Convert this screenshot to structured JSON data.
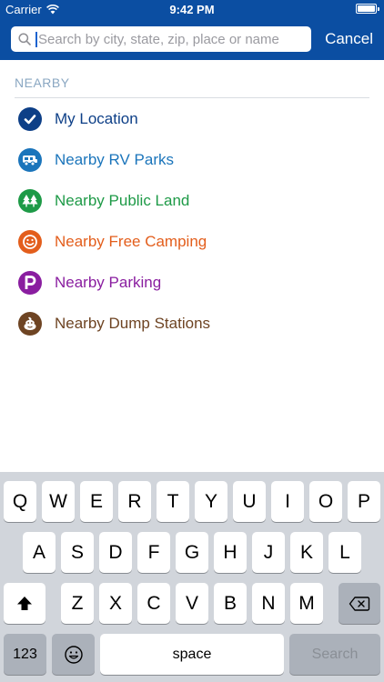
{
  "status_bar": {
    "carrier": "Carrier",
    "time": "9:42 PM"
  },
  "search": {
    "placeholder": "Search by city, state, zip, place or name",
    "value": "",
    "cancel_label": "Cancel"
  },
  "nearby": {
    "title": "NEARBY",
    "items": [
      {
        "label": "My Location",
        "icon": "checkmark-icon",
        "color": "#0d3f87"
      },
      {
        "label": "Nearby RV Parks",
        "icon": "rv-icon",
        "color": "#1b75bb"
      },
      {
        "label": "Nearby Public Land",
        "icon": "trees-icon",
        "color": "#1e9a47"
      },
      {
        "label": "Nearby Free Camping",
        "icon": "smiley-icon",
        "color": "#e35e1c"
      },
      {
        "label": "Nearby Parking",
        "icon": "parking-icon",
        "color": "#8a1ea0"
      },
      {
        "label": "Nearby Dump Stations",
        "icon": "dump-station-icon",
        "color": "#6e4423"
      }
    ]
  },
  "keyboard": {
    "row1": [
      "Q",
      "W",
      "E",
      "R",
      "T",
      "Y",
      "U",
      "I",
      "O",
      "P"
    ],
    "row2": [
      "A",
      "S",
      "D",
      "F",
      "G",
      "H",
      "J",
      "K",
      "L"
    ],
    "row3": [
      "Z",
      "X",
      "C",
      "V",
      "B",
      "N",
      "M"
    ],
    "numbers_label": "123",
    "space_label": "space",
    "search_label": "Search",
    "shift_icon": "shift-icon",
    "backspace_icon": "backspace-icon",
    "emoji_icon": "emoji-icon"
  },
  "colors": {
    "header": "#0b4ea2",
    "keyboard_bg": "#d1d5db"
  }
}
